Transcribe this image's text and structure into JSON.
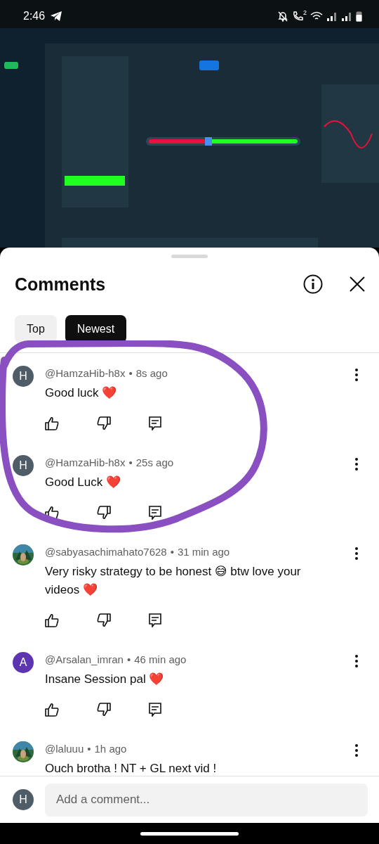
{
  "status_bar": {
    "time": "2:46",
    "call_sim": "2"
  },
  "sheet": {
    "title": "Comments"
  },
  "tabs": [
    {
      "label": "Top",
      "selected": false
    },
    {
      "label": "Newest",
      "selected": true
    }
  ],
  "comments": [
    {
      "author": "@HamzaHib-h8x",
      "separator": "•",
      "time": "8s ago",
      "text": "Good luck ❤️",
      "avatar": {
        "kind": "letter",
        "letter": "H",
        "color": "#4f5d69"
      }
    },
    {
      "author": "@HamzaHib-h8x",
      "separator": "•",
      "time": "25s ago",
      "text": "Good Luck ❤️",
      "avatar": {
        "kind": "letter",
        "letter": "H",
        "color": "#4f5d69"
      }
    },
    {
      "author": "@sabyasachimahato7628",
      "separator": "•",
      "time": "31 min ago",
      "text": "Very risky strategy to be honest 😅 btw love your videos ❤️"
    },
    {
      "author": "@Arsalan_imran",
      "separator": "•",
      "time": "46 min ago",
      "text": "Insane Session pal ❤️",
      "avatar": {
        "kind": "letter",
        "letter": "A",
        "color": "#5e35b1"
      }
    },
    {
      "author": "@laluuu",
      "separator": "•",
      "time": "1h ago",
      "text": "Ouch brotha ! NT + GL next vid !"
    }
  ],
  "composer": {
    "avatar_letter": "H",
    "placeholder": "Add a comment..."
  }
}
